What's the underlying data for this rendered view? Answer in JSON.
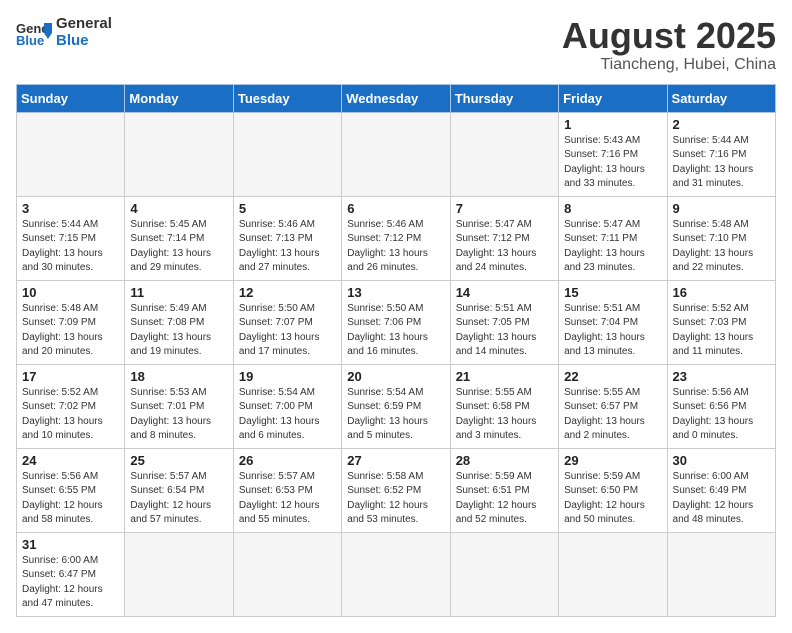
{
  "header": {
    "logo_general": "General",
    "logo_blue": "Blue",
    "title": "August 2025",
    "subtitle": "Tiancheng, Hubei, China"
  },
  "weekdays": [
    "Sunday",
    "Monday",
    "Tuesday",
    "Wednesday",
    "Thursday",
    "Friday",
    "Saturday"
  ],
  "weeks": [
    [
      {
        "num": "",
        "info": ""
      },
      {
        "num": "",
        "info": ""
      },
      {
        "num": "",
        "info": ""
      },
      {
        "num": "",
        "info": ""
      },
      {
        "num": "",
        "info": ""
      },
      {
        "num": "1",
        "info": "Sunrise: 5:43 AM\nSunset: 7:16 PM\nDaylight: 13 hours\nand 33 minutes."
      },
      {
        "num": "2",
        "info": "Sunrise: 5:44 AM\nSunset: 7:16 PM\nDaylight: 13 hours\nand 31 minutes."
      }
    ],
    [
      {
        "num": "3",
        "info": "Sunrise: 5:44 AM\nSunset: 7:15 PM\nDaylight: 13 hours\nand 30 minutes."
      },
      {
        "num": "4",
        "info": "Sunrise: 5:45 AM\nSunset: 7:14 PM\nDaylight: 13 hours\nand 29 minutes."
      },
      {
        "num": "5",
        "info": "Sunrise: 5:46 AM\nSunset: 7:13 PM\nDaylight: 13 hours\nand 27 minutes."
      },
      {
        "num": "6",
        "info": "Sunrise: 5:46 AM\nSunset: 7:12 PM\nDaylight: 13 hours\nand 26 minutes."
      },
      {
        "num": "7",
        "info": "Sunrise: 5:47 AM\nSunset: 7:12 PM\nDaylight: 13 hours\nand 24 minutes."
      },
      {
        "num": "8",
        "info": "Sunrise: 5:47 AM\nSunset: 7:11 PM\nDaylight: 13 hours\nand 23 minutes."
      },
      {
        "num": "9",
        "info": "Sunrise: 5:48 AM\nSunset: 7:10 PM\nDaylight: 13 hours\nand 22 minutes."
      }
    ],
    [
      {
        "num": "10",
        "info": "Sunrise: 5:48 AM\nSunset: 7:09 PM\nDaylight: 13 hours\nand 20 minutes."
      },
      {
        "num": "11",
        "info": "Sunrise: 5:49 AM\nSunset: 7:08 PM\nDaylight: 13 hours\nand 19 minutes."
      },
      {
        "num": "12",
        "info": "Sunrise: 5:50 AM\nSunset: 7:07 PM\nDaylight: 13 hours\nand 17 minutes."
      },
      {
        "num": "13",
        "info": "Sunrise: 5:50 AM\nSunset: 7:06 PM\nDaylight: 13 hours\nand 16 minutes."
      },
      {
        "num": "14",
        "info": "Sunrise: 5:51 AM\nSunset: 7:05 PM\nDaylight: 13 hours\nand 14 minutes."
      },
      {
        "num": "15",
        "info": "Sunrise: 5:51 AM\nSunset: 7:04 PM\nDaylight: 13 hours\nand 13 minutes."
      },
      {
        "num": "16",
        "info": "Sunrise: 5:52 AM\nSunset: 7:03 PM\nDaylight: 13 hours\nand 11 minutes."
      }
    ],
    [
      {
        "num": "17",
        "info": "Sunrise: 5:52 AM\nSunset: 7:02 PM\nDaylight: 13 hours\nand 10 minutes."
      },
      {
        "num": "18",
        "info": "Sunrise: 5:53 AM\nSunset: 7:01 PM\nDaylight: 13 hours\nand 8 minutes."
      },
      {
        "num": "19",
        "info": "Sunrise: 5:54 AM\nSunset: 7:00 PM\nDaylight: 13 hours\nand 6 minutes."
      },
      {
        "num": "20",
        "info": "Sunrise: 5:54 AM\nSunset: 6:59 PM\nDaylight: 13 hours\nand 5 minutes."
      },
      {
        "num": "21",
        "info": "Sunrise: 5:55 AM\nSunset: 6:58 PM\nDaylight: 13 hours\nand 3 minutes."
      },
      {
        "num": "22",
        "info": "Sunrise: 5:55 AM\nSunset: 6:57 PM\nDaylight: 13 hours\nand 2 minutes."
      },
      {
        "num": "23",
        "info": "Sunrise: 5:56 AM\nSunset: 6:56 PM\nDaylight: 13 hours\nand 0 minutes."
      }
    ],
    [
      {
        "num": "24",
        "info": "Sunrise: 5:56 AM\nSunset: 6:55 PM\nDaylight: 12 hours\nand 58 minutes."
      },
      {
        "num": "25",
        "info": "Sunrise: 5:57 AM\nSunset: 6:54 PM\nDaylight: 12 hours\nand 57 minutes."
      },
      {
        "num": "26",
        "info": "Sunrise: 5:57 AM\nSunset: 6:53 PM\nDaylight: 12 hours\nand 55 minutes."
      },
      {
        "num": "27",
        "info": "Sunrise: 5:58 AM\nSunset: 6:52 PM\nDaylight: 12 hours\nand 53 minutes."
      },
      {
        "num": "28",
        "info": "Sunrise: 5:59 AM\nSunset: 6:51 PM\nDaylight: 12 hours\nand 52 minutes."
      },
      {
        "num": "29",
        "info": "Sunrise: 5:59 AM\nSunset: 6:50 PM\nDaylight: 12 hours\nand 50 minutes."
      },
      {
        "num": "30",
        "info": "Sunrise: 6:00 AM\nSunset: 6:49 PM\nDaylight: 12 hours\nand 48 minutes."
      }
    ],
    [
      {
        "num": "31",
        "info": "Sunrise: 6:00 AM\nSunset: 6:47 PM\nDaylight: 12 hours\nand 47 minutes."
      },
      {
        "num": "",
        "info": ""
      },
      {
        "num": "",
        "info": ""
      },
      {
        "num": "",
        "info": ""
      },
      {
        "num": "",
        "info": ""
      },
      {
        "num": "",
        "info": ""
      },
      {
        "num": "",
        "info": ""
      }
    ]
  ]
}
